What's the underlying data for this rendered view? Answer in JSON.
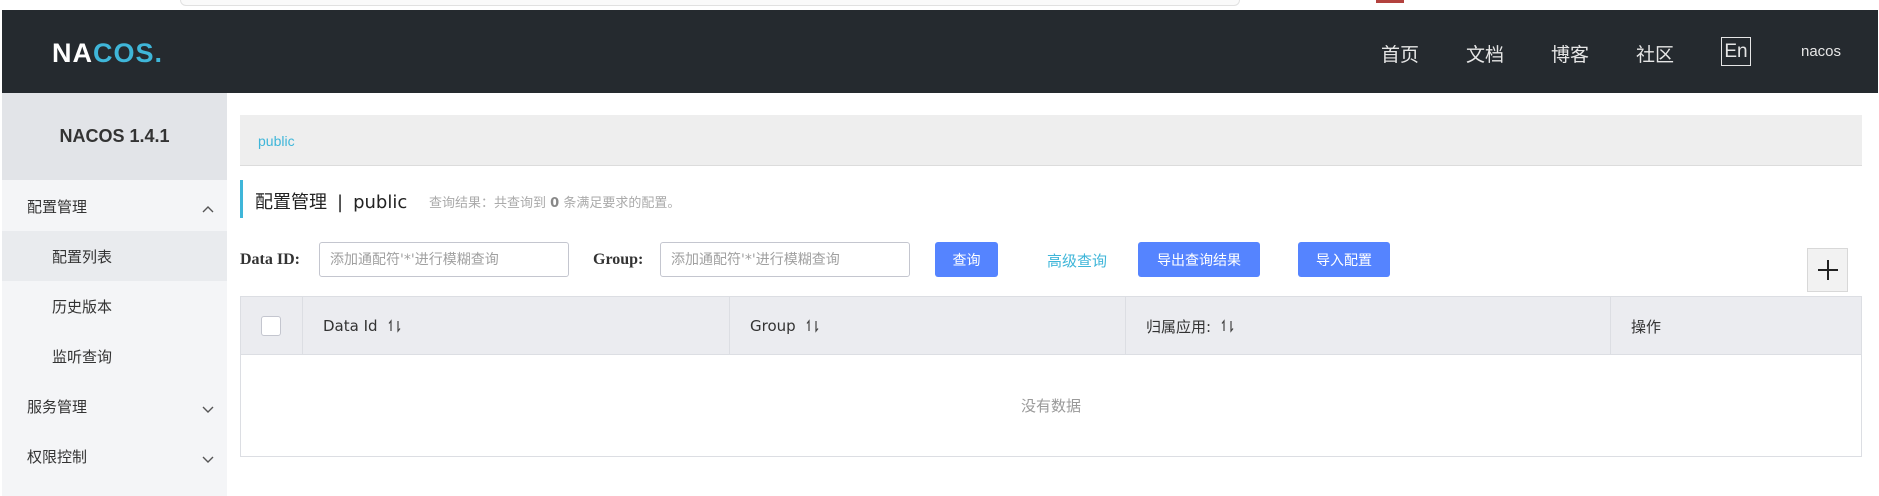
{
  "header": {
    "logo_main": "NA",
    "logo_accent": "COS",
    "logo_dot": ".",
    "nav": [
      {
        "label": "首页"
      },
      {
        "label": "文档"
      },
      {
        "label": "博客"
      },
      {
        "label": "社区"
      }
    ],
    "lang": "En",
    "user": "nacos"
  },
  "sidebar": {
    "version": "NACOS 1.4.1",
    "items": [
      {
        "label": "配置管理"
      },
      {
        "label": "配置列表"
      },
      {
        "label": "历史版本"
      },
      {
        "label": "监听查询"
      },
      {
        "label": "服务管理"
      },
      {
        "label": "权限控制"
      }
    ]
  },
  "namespace": {
    "current": "public"
  },
  "title": {
    "main": "配置管理",
    "separator": "|",
    "namespace": "public",
    "result_prefix": "查询结果：共查询到",
    "result_count": "0",
    "result_suffix": "条满足要求的配置。"
  },
  "filters": {
    "dataid_label": "Data ID:",
    "dataid_placeholder": "添加通配符'*'进行模糊查询",
    "group_label": "Group:",
    "group_placeholder": "添加通配符'*'进行模糊查询",
    "search_button": "查询",
    "advanced_link": "高级查询",
    "export_button": "导出查询结果",
    "import_button": "导入配置"
  },
  "table": {
    "columns": [
      "Data Id",
      "Group",
      "归属应用:",
      "操作"
    ],
    "empty_text": "没有数据"
  },
  "colors": {
    "header_bg": "#252a2f",
    "accent": "#3fb6d9",
    "primary_button": "#5584ff"
  }
}
